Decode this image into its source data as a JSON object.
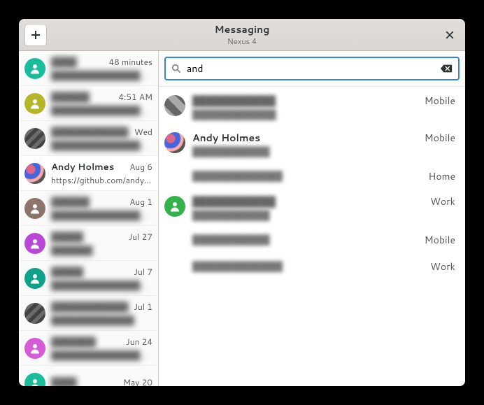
{
  "header": {
    "title": "Messaging",
    "subtitle": "Nexus 4"
  },
  "search": {
    "value": "and"
  },
  "sidebar": {
    "items": [
      {
        "name": "████",
        "preview": "█████████████████████",
        "time": "48 minutes",
        "avatar": "teal",
        "blur": true
      },
      {
        "name": "██████",
        "preview": "██████████████████…",
        "time": "4:51 AM",
        "avatar": "olive",
        "blur": true
      },
      {
        "name": "████████████",
        "preview": "████████████████████",
        "time": "Wed",
        "avatar": "photo2",
        "blur": true
      },
      {
        "name": "Andy Holmes",
        "preview": "https://github.com/andy…",
        "time": "Aug 6",
        "avatar": "photo3",
        "blur": false,
        "selected": true
      },
      {
        "name": "██████",
        "preview": "████████████████…",
        "time": "Aug 1",
        "avatar": "brown",
        "blur": true
      },
      {
        "name": "█████",
        "preview": "███████",
        "time": "Jul 27",
        "avatar": "magenta",
        "blur": true
      },
      {
        "name": "█████",
        "preview": "████████████████████ …",
        "time": "Jul 7",
        "avatar": "teal2",
        "blur": true
      },
      {
        "name": "████████████",
        "preview": "██████████████",
        "time": "Jul 1",
        "avatar": "photo2",
        "blur": true
      },
      {
        "name": "███████",
        "preview": "██████████████████████",
        "time": "Jun 24",
        "avatar": "pink",
        "blur": true
      },
      {
        "name": "████",
        "preview": "",
        "time": "May 20",
        "avatar": "teal",
        "blur": true
      }
    ]
  },
  "results": [
    {
      "name": "████████████",
      "avatar": "p1",
      "blur": true,
      "numbers": [
        {
          "num": "█████████████",
          "type": "Mobile",
          "blur": true
        }
      ]
    },
    {
      "name": "Andy Holmes",
      "avatar": "p2",
      "blur": false,
      "numbers": [
        {
          "num": "████████████",
          "type": "Mobile",
          "blur": true
        },
        {
          "num": "██████████████",
          "type": "Home",
          "blur": true
        }
      ]
    },
    {
      "name": "████████████",
      "avatar": "green",
      "blur": true,
      "numbers": [
        {
          "num": "████████████",
          "type": "Work",
          "blur": true
        },
        {
          "num": "████████████",
          "type": "Mobile",
          "blur": true
        },
        {
          "num": "██████████████",
          "type": "Work",
          "blur": true
        }
      ]
    }
  ]
}
